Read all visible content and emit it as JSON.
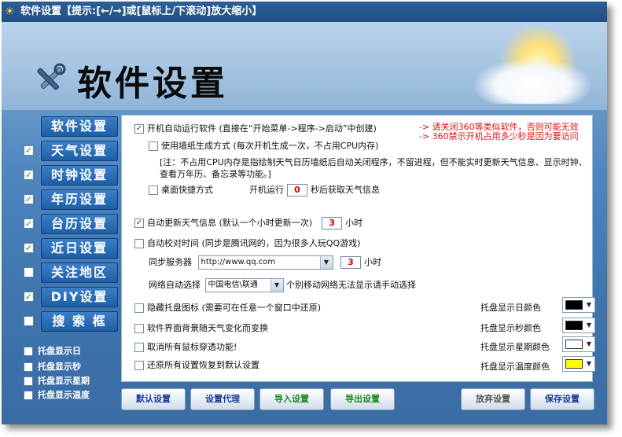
{
  "window": {
    "title": "软件设置【提示:[←/→]或[鼠标上/下滚动]放大缩小】",
    "header_title": "软件设置"
  },
  "nav": [
    {
      "label": "软件设置",
      "checked": false,
      "has_check": false
    },
    {
      "label": "天气设置",
      "checked": true,
      "has_check": true
    },
    {
      "label": "时钟设置",
      "checked": true,
      "has_check": true
    },
    {
      "label": "年历设置",
      "checked": true,
      "has_check": true
    },
    {
      "label": "台历设置",
      "checked": true,
      "has_check": true
    },
    {
      "label": "近日设置",
      "checked": true,
      "has_check": true
    },
    {
      "label": "关注地区",
      "checked": false,
      "has_check": true
    },
    {
      "label": "DIY设置",
      "checked": true,
      "has_check": true
    },
    {
      "label": "搜 索 框",
      "checked": false,
      "has_check": true
    }
  ],
  "side_options": [
    "托盘显示日",
    "托盘显示秒",
    "托盘显示星期",
    "托盘显示温度"
  ],
  "settings": {
    "autorun": "开机自动运行软件 (直接在“开始菜单->程序->启动”中创建)",
    "autorun_checked": "✓",
    "wallpaper": "使用墙纸生成方式 (每次开机生成一次，不占用CPU内存)",
    "note": "[注：不占用CPU内存是指绘制天气日历墙纸后自动关闭程序，不留进程，但不能实时更新天气信息、显示时钟、查看万年历、备忘录等功能。]",
    "desktop_shortcut": "桌面快捷方式",
    "boot_run": "开机运行",
    "boot_seconds": "0",
    "boot_suffix": "秒后获取天气信息",
    "auto_update": "自动更新天气信息 (默认一个小时更新一次)",
    "auto_update_checked": "✓",
    "update_hours": "3",
    "hours_unit": "小时",
    "auto_sync": "自动校对时间 (同步是腾讯网的，因为很多人玩QQ游戏)",
    "sync_server_label": "同步服务器",
    "sync_server": "http://www.qq.com",
    "sync_hours": "3",
    "network_label": "网络自动选择",
    "network_value": "中国电信\\联通",
    "network_note": "个别移动网络无法显示请手动选择",
    "hide_tray": "隐藏托盘图标 (需要可在任意一个窗口中还原)",
    "bg_follow": "软件界面背景随天气变化而变换",
    "cancel_mouse": "取消所有鼠标穿透功能!",
    "restore_default": "还原所有设置恢复到默认设置"
  },
  "notes": {
    "line1": "-> 请关闭360等类似软件，否则可能无效",
    "line2": "-> 360禁示开机占用多少秒是因为要访问"
  },
  "colors": {
    "day_label": "托盘显示日颜色",
    "day_color": "#000000",
    "sec_label": "托盘显示秒颜色",
    "sec_color": "#000000",
    "week_label": "托盘显示星期颜色",
    "week_color": "#ffffff",
    "temp_label": "托盘显示温度颜色",
    "temp_color": "#ffff00"
  },
  "buttons": {
    "default": "默认设置",
    "proxy": "设置代理",
    "import": "导入设置",
    "export": "导出设置",
    "discard": "放弃设置",
    "save": "保存设置"
  }
}
